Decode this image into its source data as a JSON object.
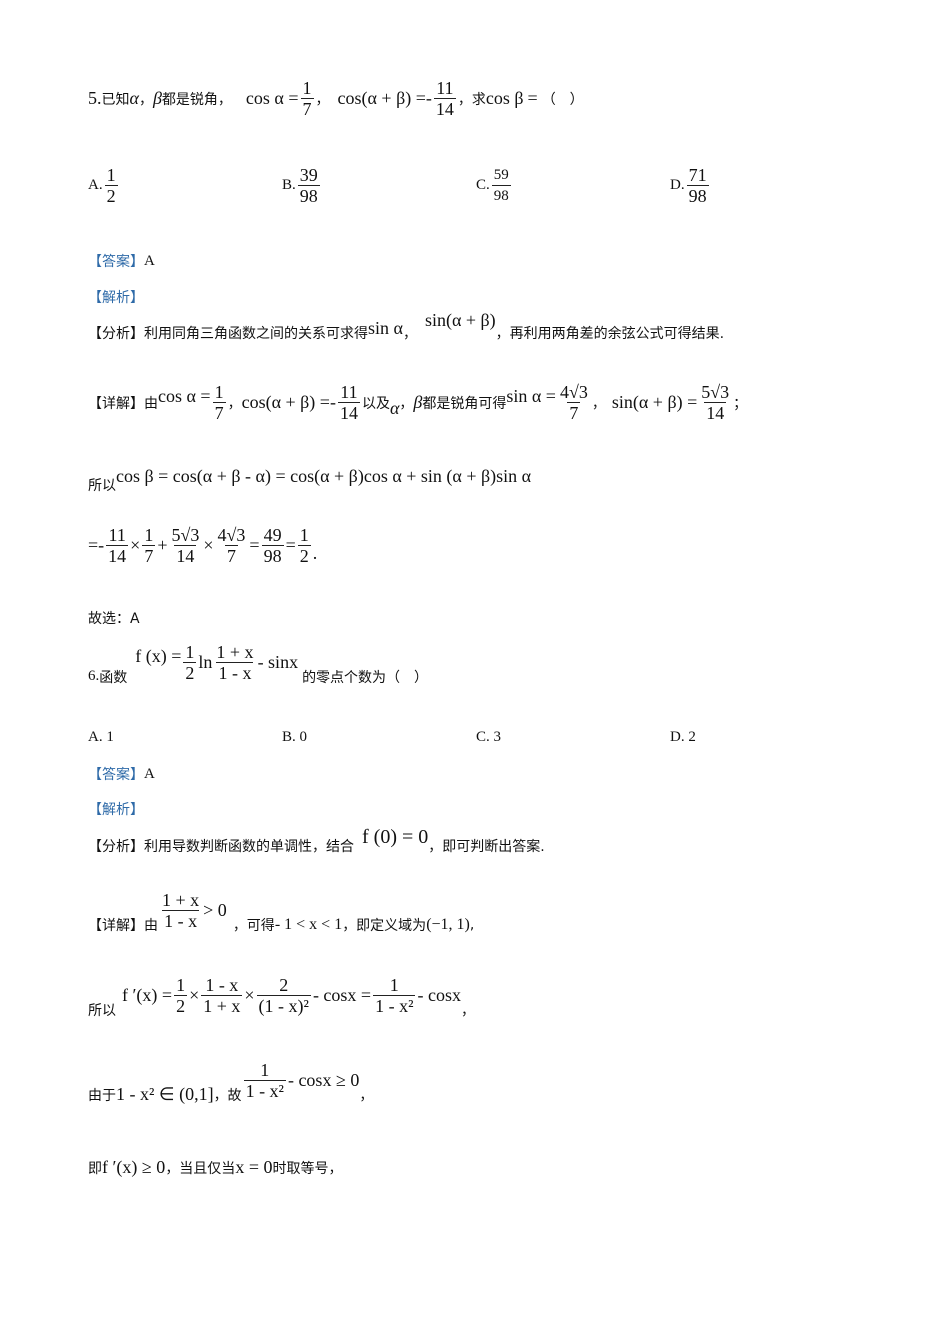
{
  "q5": {
    "number": "5.",
    "prefix": "已知",
    "alpha": "α",
    "comma1": "，",
    "beta": "β",
    "are_acute": "都是锐角，",
    "cos_alpha_lhs": "cos α =",
    "frac1_num": "1",
    "frac1_den": "7",
    "comma2": "，",
    "cos_ab_lhs": "cos(α + β) =-",
    "frac2_num": "11",
    "frac2_den": "14",
    "ask": "，求",
    "ask_expr": "cos β",
    "ask_eq": "=",
    "paren": "（　）",
    "options": [
      {
        "label": "A.",
        "num": "1",
        "den": "2"
      },
      {
        "label": "B.",
        "num": "39",
        "den": "98"
      },
      {
        "label": "C.",
        "num": "59",
        "den": "98"
      },
      {
        "label": "D.",
        "num": "71",
        "den": "98"
      }
    ],
    "answer_tag": "【答案】",
    "answer": "A",
    "analysis_tag": "【解析】",
    "fenxi_tag": "【分析】",
    "fenxi_text1": "利用同角三角函数之间的关系可求得",
    "fenxi_sin_a": "sin α",
    "fenxi_comma": "，",
    "fenxi_sin_ab": "sin(α + β)",
    "fenxi_text2": "，再利用两角差的余弦公式可得结果.",
    "xiangjie_tag": "【详解】",
    "xj_you": "由",
    "xj_cos_a": "cos α =",
    "xj_f1_num": "1",
    "xj_f1_den": "7",
    "xj_comma1": "，",
    "xj_cos_ab": "cos(α + β) =-",
    "xj_f2_num": "11",
    "xj_f2_den": "14",
    "xj_yiji": "以及",
    "xj_alpha": "α",
    "xj_comma2": "，",
    "xj_beta": "β",
    "xj_text": "都是锐角可得",
    "xj_sin_a": "sin α =",
    "xj_f3_num": "4√3",
    "xj_f3_den": "7",
    "xj_comma3": "，",
    "xj_sin_ab": "sin(α + β) =",
    "xj_f4_num": "5√3",
    "xj_f4_den": "14",
    "xj_end": "；",
    "suoyi": "所以",
    "suoyi_expr": "cos β = cos(α + β - α) = cos(α + β)cos α + sin (α + β)sin α",
    "calc_prefix": "=-",
    "calc_f1_num": "11",
    "calc_f1_den": "14",
    "calc_times1": "×",
    "calc_f2_num": "1",
    "calc_f2_den": "7",
    "calc_plus": "+",
    "calc_f3_num": "5√3",
    "calc_f3_den": "14",
    "calc_times2": "×",
    "calc_f4_num": "4√3",
    "calc_f4_den": "7",
    "calc_eq1": "=",
    "calc_f5_num": "49",
    "calc_f5_den": "98",
    "calc_eq2": "=",
    "calc_f6_num": "1",
    "calc_f6_den": "2",
    "calc_end": ".",
    "guxuan": "故选：A"
  },
  "q6": {
    "number": "6.",
    "prefix": "函数",
    "f_lhs": "f (x) =",
    "half_num": "1",
    "half_den": "2",
    "ln": "ln",
    "ln_num": "1 + x",
    "ln_den": "1 - x",
    "minus_sin": "- sinx",
    "suffix": "的零点个数为（　）",
    "options": [
      {
        "label": "A.",
        "value": "1"
      },
      {
        "label": "B.",
        "value": "0"
      },
      {
        "label": "C.",
        "value": "3"
      },
      {
        "label": "D.",
        "value": "2"
      }
    ],
    "answer_tag": "【答案】",
    "answer": "A",
    "analysis_tag": "【解析】",
    "fenxi_tag": "【分析】",
    "fenxi_text1": "利用导数判断函数的单调性，结合",
    "fenxi_expr": "f (0) = 0",
    "fenxi_text2": "，即可判断出答案.",
    "xiangjie_tag": "【详解】",
    "xj_you": "由",
    "xj_f_num": "1 + x",
    "xj_f_den": "1 - x",
    "xj_gt": "> 0",
    "xj_text1": "，可得",
    "xj_range": "- 1 < x < 1",
    "xj_text2": "，即定义域为",
    "xj_domain": "(−1, 1)",
    "xj_end": ",",
    "suoyi": "所以",
    "d_lhs": "f ′(x) =",
    "d_f1_num": "1",
    "d_f1_den": "2",
    "d_times1": "×",
    "d_f2_num": "1 - x",
    "d_f2_den": "1 + x",
    "d_times2": "×",
    "d_f3_num": "2",
    "d_f3_den": "(1 - x)²",
    "d_mid": "- cosx =",
    "d_f4_num": "1",
    "d_f4_den": "1 - x²",
    "d_tail": "- cosx",
    "d_end": "，",
    "youyu": "由于",
    "youyu_expr": "1 - x² ∈ (0,1]",
    "youyu_gu": "，故",
    "youyu_f_num": "1",
    "youyu_f_den": "1 - x²",
    "youyu_tail": "- cosx ≥ 0",
    "youyu_end": "，",
    "ji": "即",
    "ji_expr": "f ′(x) ≥ 0",
    "ji_text1": "，当且仅当",
    "ji_x0": "x = 0",
    "ji_text2": "时取等号，"
  }
}
